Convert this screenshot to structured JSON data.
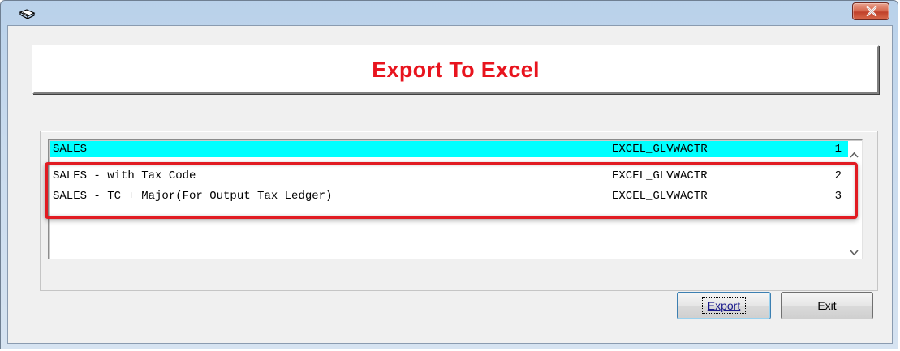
{
  "window": {
    "app_icon": "book-icon",
    "close_icon": "close-icon"
  },
  "banner": {
    "title": "Export To Excel",
    "title_color": "#e8141e"
  },
  "list": {
    "selected_color": "#00ffff",
    "items": [
      {
        "name": "SALES",
        "code": "EXCEL_GLVWACTR",
        "number": "1",
        "selected": true
      },
      {
        "name": "SALES - with Tax Code",
        "code": "EXCEL_GLVWACTR",
        "number": "2",
        "selected": false
      },
      {
        "name": "SALES - TC + Major(For Output Tax Ledger)",
        "code": "EXCEL_GLVWACTR",
        "number": "3",
        "selected": false
      }
    ],
    "scroll_up_icon": "chevron-up-icon",
    "scroll_down_icon": "chevron-down-icon"
  },
  "annotation": {
    "highlight_color": "#e11b22"
  },
  "buttons": {
    "export_label": "Export",
    "exit_label": "Exit"
  }
}
